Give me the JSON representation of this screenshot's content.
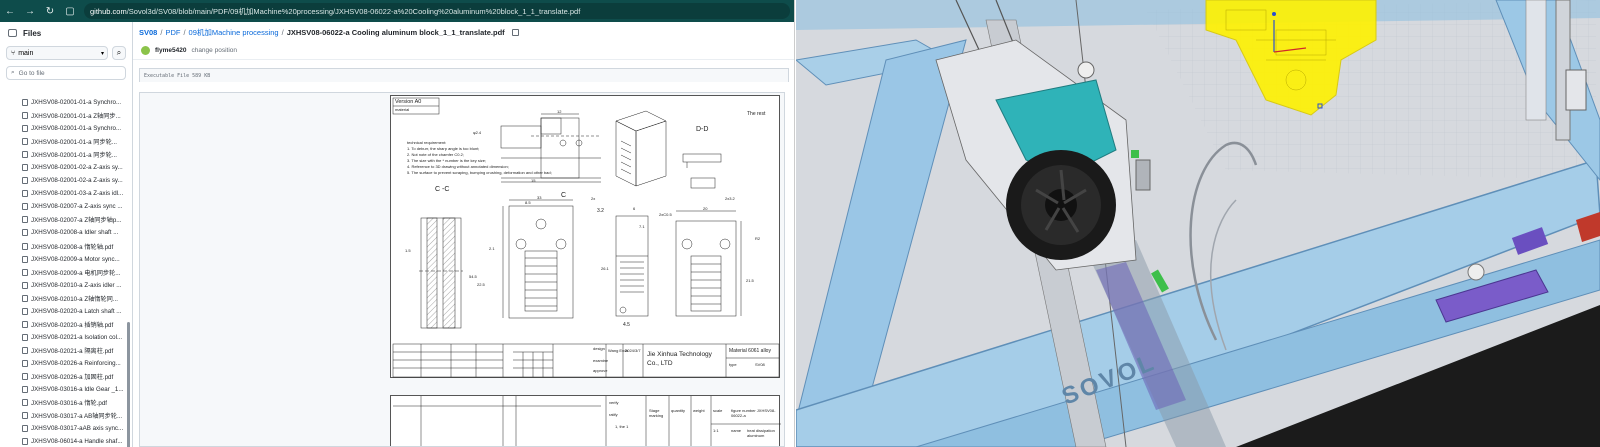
{
  "browser": {
    "url_host": "github.com",
    "url_path": "/Sovol3d/SV08/blob/main/PDF/09机加Machine%20processing/JXHSV08-06022-a%20Cooling%20aluminum%20block_1_1_translate.pdf"
  },
  "sidebar": {
    "title": "Files",
    "branch": "main",
    "goto_placeholder": "Go to file",
    "files": [
      "JXHSV08-02001-01-a Synchro...",
      "JXHSV08-02001-01-a Z轴同步...",
      "JXHSV08-02001-01-a Synchro...",
      "JXHSV08-02001-01-a 同步轮...",
      "JXHSV08-02001-01-a 同步轮...",
      "JXHSV08-02001-02-a Z-axis sy...",
      "JXHSV08-02001-02-a Z-axis sy...",
      "JXHSV08-02001-03-a Z-axis idl...",
      "JXHSV08-02007-a Z-axis sync ...",
      "JXHSV08-02007-a Z轴同步轴p...",
      "JXHSV08-02008-a Idler shaft ...",
      "JXHSV08-02008-a 惰轮轴.pdf",
      "JXHSV08-02009-a Motor sync...",
      "JXHSV08-02009-a 电机同步轮...",
      "JXHSV08-02010-a Z-axis idler ...",
      "JXHSV08-02010-a Z轴惰轮同...",
      "JXHSV08-02020-a Latch shaft ...",
      "JXHSV08-02020-a 插销轴.pdf",
      "JXHSV08-02021-a Isolation col...",
      "JXHSV08-02021-a 隔离柱.pdf",
      "JXHSV08-02026-a Reinforcing...",
      "JXHSV08-02026-a 加固柱.pdf",
      "JXHSV08-03016-a Idle Gear _1...",
      "JXHSV08-03016-a 惰轮.pdf",
      "JXHSV08-03017-a AB轴同步轮...",
      "JXHSV08-03017-aAB axis sync...",
      "JXHSV08-06014-a Handle shaf...",
      "JXHSV08-06014-a 手柄轴.pdf"
    ]
  },
  "main": {
    "breadcrumb": {
      "repo": "SV08",
      "sep": "/",
      "dir1": "PDF",
      "dir2": "09机加Machine processing",
      "file": "JXHSV08-06022-a Cooling aluminum block_1_1_translate.pdf"
    },
    "commit": {
      "user": "flyme5420",
      "message": "change position"
    },
    "file_info": "Executable File  589 KB"
  },
  "drawing": {
    "version": "Version A0",
    "material_small": "material",
    "tech_title": "technical requirement:",
    "tech_lines": [
      "1. To deburr, the sharp angle is too blunt;",
      "2. Not note of the chamfer C0.2;",
      "3. The size with the * number is the key size;",
      "4. Reference to 3D drawing without annotated dimension;",
      "5. The surface to prevent scraping, bumping crushing, deformation and other bad;"
    ],
    "section_cc": "C -C",
    "section_dd": "D-D",
    "rest_label": "The rest",
    "company": "Jie Xinhua Technology Co., LTD",
    "material_block": "Material 6061 alloy",
    "type_label": "type",
    "type_value": "SV08",
    "designer": "Wang Erda",
    "date": "2024/3/7",
    "design_label": "design",
    "examine_label": "examine",
    "approve_label": "approve",
    "stage_marking": "Stage marking",
    "quantity": "quantity",
    "weight": "weight",
    "scale": "scale",
    "scale_val": "1:1",
    "figure_number": "figure number JXHSV08-06022-a",
    "name_label": "name",
    "name_value": "heat dissipation aluminum",
    "verify": "verify",
    "ratify": "ratify",
    "the1": "1, the 1",
    "dims": {
      "d1": "12",
      "d2": "15",
      "d3": "33",
      "d4": "8.5",
      "d5": "20",
      "d6": "6",
      "d7": "3.2",
      "d8": "1.5",
      "d9": "2.1",
      "d10": "54.5",
      "d11": "22.5",
      "d12": "26.1",
      "d13": "21.5",
      "d14": "R2",
      "d15": "2x",
      "d16": "7.1",
      "d17": "4.5",
      "d18": "2x3.2",
      "d19": "2xC0.5",
      "d20": "φ2.4",
      "d21": "C"
    }
  },
  "cad": {
    "brand": "SOVOL"
  }
}
